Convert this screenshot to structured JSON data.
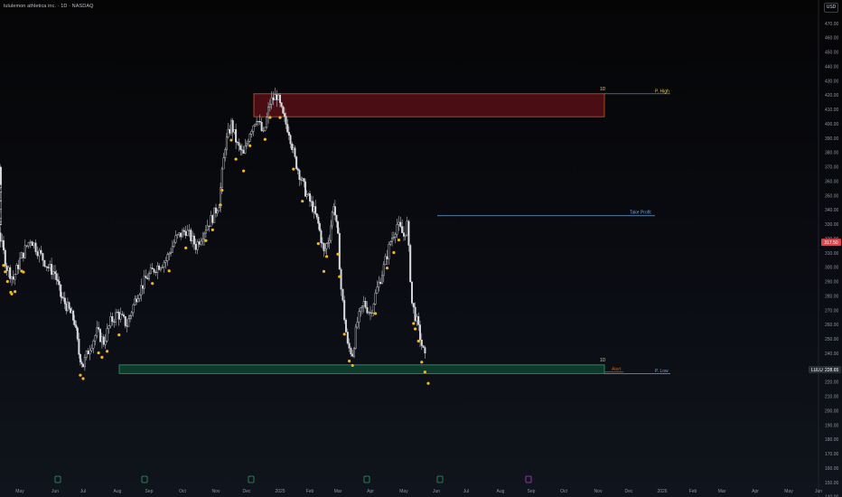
{
  "header": {
    "title": "lululemon athletica inc. · 1D · NASDAQ",
    "currency_button": "USD"
  },
  "colors": {
    "background": "#0b0c10",
    "candle": "#d9dbe0",
    "moving_average": "#e0424b",
    "signal_dot": "#f5b51e",
    "resistance_zone_fill": "#4a0d14",
    "resistance_zone_border": "#c25a1e",
    "support_zone_fill": "#0e3a2c",
    "support_zone_border": "#2e9c6f",
    "level_line": "#6aa0d8",
    "price_tag": "#e0424b",
    "event_icon": "#26a269",
    "event_icon_alt": "#b03dd4"
  },
  "chart_data": {
    "type": "line",
    "title": "lululemon athletica inc. · 1D · NASDAQ",
    "xlabel": "",
    "ylabel": "",
    "x_tick_labels": [
      "May",
      "Jun",
      "Jul",
      "Aug",
      "Sep",
      "Oct",
      "Nov",
      "Dec",
      "2025",
      "Feb",
      "Mar",
      "Apr",
      "May",
      "Jun",
      "Jul",
      "Aug",
      "Sep",
      "Oct",
      "Nov",
      "Dec",
      "2026",
      "Feb",
      "Mar",
      "Apr",
      "May",
      "Jun"
    ],
    "y_tick_labels": [
      "470.00",
      "460.00",
      "450.00",
      "440.00",
      "430.00",
      "420.00",
      "410.00",
      "400.00",
      "390.00",
      "380.00",
      "370.00",
      "360.00",
      "350.00",
      "340.00",
      "330.00",
      "320.00",
      "310.00",
      "300.00",
      "290.00",
      "280.00",
      "270.00",
      "260.00",
      "250.00",
      "240.00",
      "230.00",
      "220.00",
      "210.00",
      "200.00",
      "190.00",
      "180.00",
      "170.00",
      "160.00",
      "150.00",
      "140.00"
    ],
    "ylim": [
      138,
      472
    ],
    "grid": false,
    "price_series": {
      "name": "LULU",
      "x": [
        "Apr",
        "May",
        "Jun",
        "Jul",
        "Aug",
        "Sep",
        "Oct",
        "Nov",
        "Dec",
        "2025",
        "Feb",
        "Mar",
        "Apr",
        "May",
        "Jun"
      ],
      "close": [
        335,
        345,
        305,
        310,
        230,
        255,
        275,
        315,
        410,
        385,
        410,
        320,
        245,
        320,
        250
      ]
    },
    "moving_average": {
      "x": [
        "Apr",
        "May",
        "Jun",
        "Jul",
        "Aug",
        "Sep",
        "Oct",
        "Nov",
        "Dec",
        "2025",
        "Feb",
        "Mar",
        "Apr",
        "May",
        "Jun"
      ],
      "values": [
        420,
        400,
        378,
        352,
        332,
        322,
        318,
        318,
        325,
        335,
        345,
        345,
        340,
        330,
        318
      ]
    },
    "levels": [
      {
        "label": "P. High",
        "value": 421,
        "timeframe": "1D"
      },
      {
        "label": "Take Profit",
        "value": 336
      },
      {
        "label": "Alert",
        "value": 227
      },
      {
        "label": "P. Low",
        "value": 226,
        "timeframe": "1D"
      }
    ],
    "resistance_zone": {
      "from": 405,
      "to": 421
    },
    "support_zone": {
      "from": 226,
      "to": 232
    },
    "price_tags": [
      {
        "label": "317.50",
        "value": 317.5
      },
      {
        "label": "LULU",
        "value": 228.65,
        "price": "228.65"
      }
    ]
  },
  "levels_text": {
    "zone_high_tf": "1D",
    "zone_low_tf": "1D",
    "p_high": "P. High",
    "take_profit": "Take Profit",
    "alert": "Alert",
    "p_low": "P. Low",
    "ma_tag": "317.50",
    "last_symbol": "LULU",
    "last_price": "228.65"
  }
}
